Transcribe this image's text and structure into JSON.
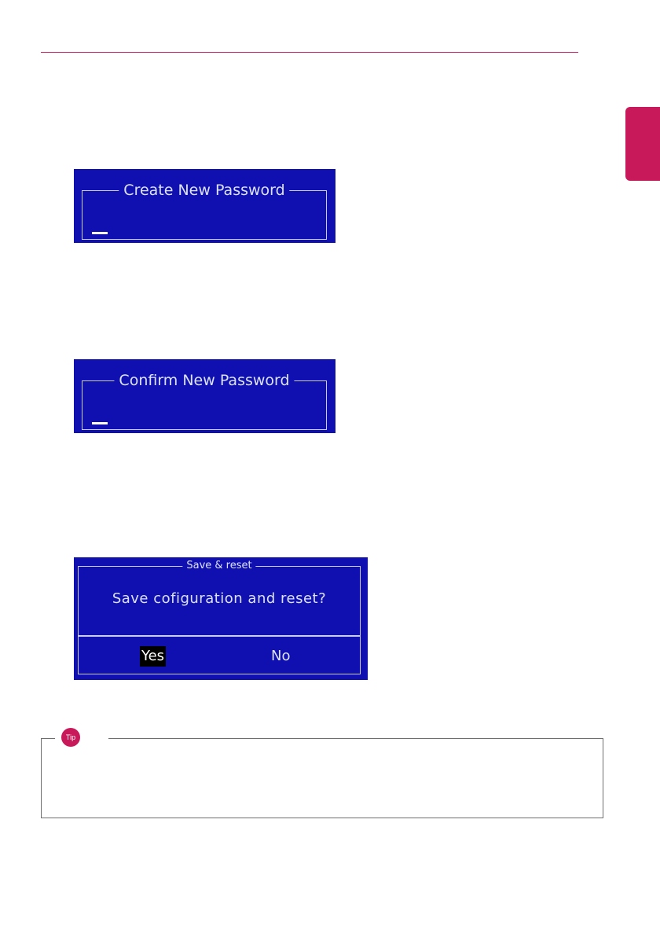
{
  "colors": {
    "accent": "#c8195a",
    "bios_background": "#1010b0",
    "bios_text": "#dde3f7",
    "selection_background": "#000000"
  },
  "dialogs": {
    "create_password": {
      "title": "Create New Password",
      "value": ""
    },
    "confirm_password": {
      "title": "Confirm New Password",
      "value": ""
    },
    "save_reset": {
      "title": "Save & reset",
      "message": "Save cofiguration and reset?",
      "options": [
        {
          "label": "Yes",
          "selected": true
        },
        {
          "label": "No",
          "selected": false
        }
      ]
    }
  },
  "tip": {
    "badge": "Tip"
  }
}
